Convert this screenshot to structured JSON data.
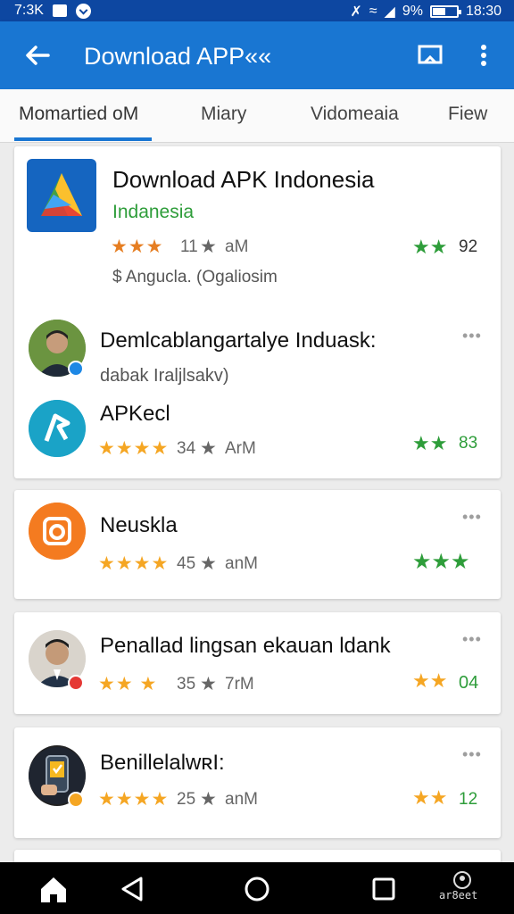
{
  "status": {
    "time_left": "7:3K",
    "battery": "9%",
    "time_right": "18:30"
  },
  "appbar": {
    "title": "Download APP««",
    "back_icon": "arrow-back-icon",
    "action1_icon": "bookmark-frame-icon",
    "action2_icon": "overflow-menu-icon"
  },
  "tabs": [
    {
      "label": "Momartied oM",
      "selected": true
    },
    {
      "label": "Miary",
      "selected": false
    },
    {
      "label": "Vidomeaia",
      "selected": false
    },
    {
      "label": "Fiew",
      "selected": false
    }
  ],
  "featured": {
    "title": "Download APK Indonesia",
    "subtitle": "Indanesia",
    "stars": "★★★",
    "rating_meta": "11",
    "rating_unit": "aM",
    "right_stars": "★★",
    "right_value": "92",
    "developer": "$ Angucla. (Ogaliosim"
  },
  "list1": {
    "item_a": {
      "title": "Demlcablangartalye Induask:",
      "subtitle": "dabak Iraljlsakv)"
    },
    "item_b": {
      "title": "APKecl",
      "stars": "★★★★",
      "meta": "34",
      "unit": "ArM",
      "right_stars": "★★",
      "right_value": "83"
    }
  },
  "items": [
    {
      "title": "Neuskla",
      "stars": "★★★★",
      "meta": "45",
      "unit": "anM",
      "right_stars": "★★★",
      "right_value": ""
    },
    {
      "title": "Penallad lingsan ekauan ldank",
      "stars": "★★ ★",
      "meta": "35",
      "unit": "7rM",
      "right_stars": "★★",
      "right_value": "04"
    },
    {
      "title": "BenillelalwʀI:",
      "stars": "★★★★",
      "meta": "25",
      "unit": "anM",
      "right_stars": "★★",
      "right_value": "12"
    }
  ],
  "more_label": "•••",
  "gray_star": "★",
  "navbar": {
    "label": "ar8eet"
  },
  "colors": {
    "status_bar": "#0d47a1",
    "app_bar": "#1976d2",
    "accent_green": "#2e9d3a",
    "star_orange": "#f5a623"
  }
}
